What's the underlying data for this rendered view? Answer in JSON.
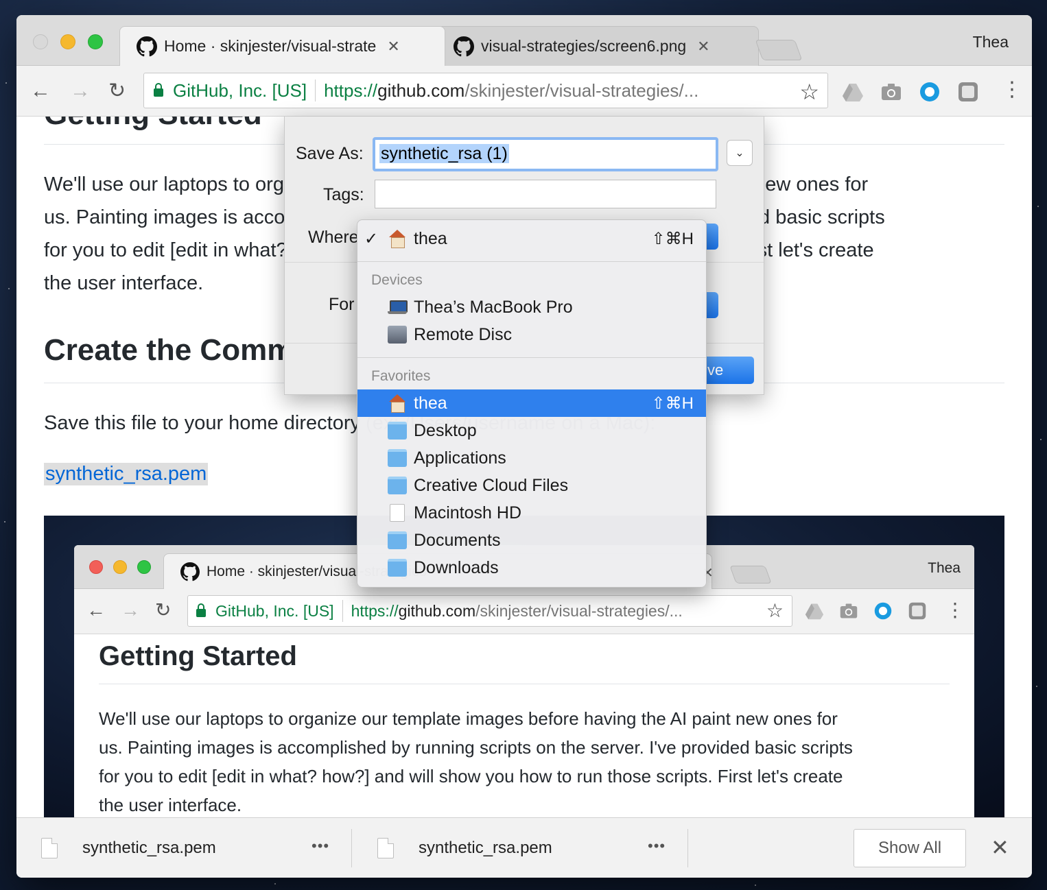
{
  "browser": {
    "tabs": [
      {
        "title": "Home · skinjester/visual-strate",
        "active": true
      },
      {
        "title": "visual-strategies/screen6.png",
        "active": false
      }
    ],
    "profile": "Thea",
    "omnibox": {
      "ev_name": "GitHub, Inc. [US]",
      "scheme": "https://",
      "host": "github.com",
      "path": "/skinjester/visual-strategies/..."
    },
    "extensions": [
      "drive-icon",
      "camera-icon",
      "circle-icon",
      "shield-icon"
    ]
  },
  "page": {
    "heading_cut": "Getting Started",
    "paragraph_lines": [
      "We'll use our laptops to organize our template images before having the AI paint new ones for",
      "us. Painting images is accomplished by running scripts on the server. I've provided basic scripts",
      "for you to edit [edit in what? how?] and will show you how to run those scripts. First let's create",
      "the user interface."
    ],
    "heading2": "Create the Command Files",
    "save_text": "Save this file to your home directory (ex: /Users/username on a Mac):",
    "link": "synthetic_rsa.pem",
    "embedded": {
      "tab_title": "Home · skinjester/visual-strategies",
      "profile": "Thea",
      "ev_name": "GitHub, Inc. [US]",
      "scheme": "https://",
      "host": "github.com",
      "path": "/skinjester/visual-strategies/...",
      "heading": "Getting Started",
      "paragraph_lines": [
        "We'll use our laptops to organize our template images before having the AI paint new ones for",
        "us. Painting images is accomplished by running scripts on the server. I've provided basic scripts",
        "for you to edit [edit in what? how?] and will show you how to run those scripts. First let's create",
        "the user interface."
      ]
    }
  },
  "save_dialog": {
    "save_as_label": "Save As:",
    "save_as_value": "synthetic_rsa (1)",
    "tags_label": "Tags:",
    "where_label": "Where",
    "format_label": "For",
    "save_button_fragment": "ve",
    "where_menu": {
      "current": {
        "label": "thea",
        "shortcut": "⇧⌘H",
        "checked": true,
        "icon": "home-icon"
      },
      "sections": [
        {
          "title": "Devices",
          "items": [
            {
              "label": "Thea’s MacBook Pro",
              "icon": "laptop-icon"
            },
            {
              "label": "Remote Disc",
              "icon": "remote-disc-icon"
            }
          ]
        },
        {
          "title": "Favorites",
          "items": [
            {
              "label": "thea",
              "shortcut": "⇧⌘H",
              "icon": "home-icon",
              "selected": true
            },
            {
              "label": "Desktop",
              "icon": "desktop-folder-icon"
            },
            {
              "label": "Applications",
              "icon": "applications-folder-icon"
            },
            {
              "label": "Creative Cloud Files",
              "icon": "creative-cloud-folder-icon"
            },
            {
              "label": "Macintosh HD",
              "icon": "drive-document-icon"
            },
            {
              "label": "Documents",
              "icon": "documents-folder-icon"
            },
            {
              "label": "Downloads",
              "icon": "downloads-folder-icon"
            }
          ]
        }
      ]
    }
  },
  "downloads": {
    "items": [
      {
        "name": "synthetic_rsa.pem"
      },
      {
        "name": "synthetic_rsa.pem"
      }
    ],
    "more": "•••",
    "show_all": "Show All"
  },
  "colors": {
    "accent": "#2f80ed",
    "secure_green": "#0b8043",
    "link_blue": "#0366d6"
  }
}
